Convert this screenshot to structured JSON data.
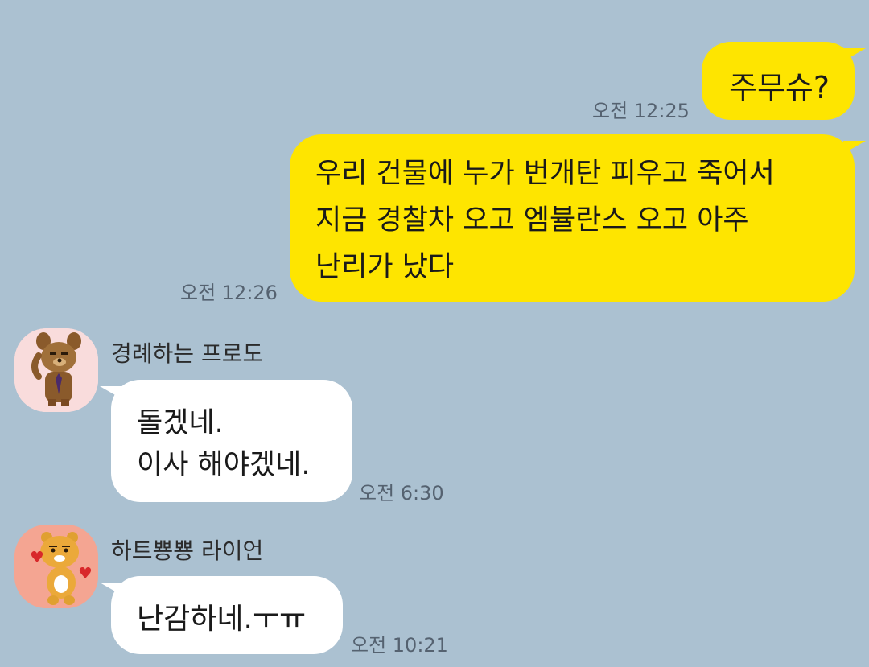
{
  "colors": {
    "background": "#abc1d1",
    "my_bubble": "#fee500",
    "their_bubble": "#ffffff",
    "timestamp": "#556270"
  },
  "messages": [
    {
      "direction": "outgoing",
      "text": "주무슈?",
      "time": "오전 12:25"
    },
    {
      "direction": "outgoing",
      "text": "우리 건물에 누가 번개탄 피우고 죽어서\n지금 경찰차 오고 엠뷸란스 오고 아주\n난리가 났다",
      "time": "오전 12:26"
    },
    {
      "direction": "incoming",
      "sender": "경례하는 프로도",
      "avatar": "frodo-salute-avatar",
      "text": "돌겠네.\n이사 해야겠네.",
      "time": "오전 6:30"
    },
    {
      "direction": "incoming",
      "sender": "하트뿅뿅 라이언",
      "avatar": "ryan-heart-avatar",
      "text": "난감하네.ㅜㅠ",
      "time": "오전 10:21"
    }
  ]
}
